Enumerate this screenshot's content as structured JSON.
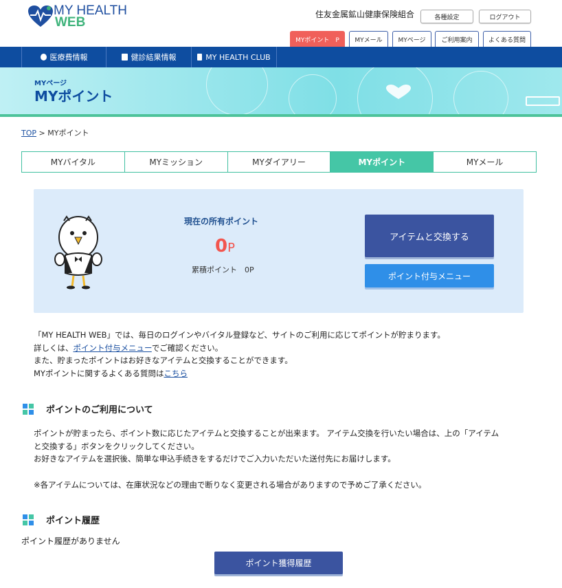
{
  "header": {
    "logo_line1": "MY HEALTH",
    "logo_line2": "WEB",
    "org_name": "住友金属鉱山健康保険組合",
    "settings_label": "各種設定",
    "logout_label": "ログアウト",
    "tabs": [
      {
        "label": "MYポイント　P",
        "active": true
      },
      {
        "label": "MYメール"
      },
      {
        "label": "MYページ"
      },
      {
        "label": "ご利用案内"
      },
      {
        "label": "よくある質問"
      }
    ]
  },
  "nav": {
    "items": [
      {
        "label": "医療費情報",
        "icon": "coins-icon"
      },
      {
        "label": "健診結果情報",
        "icon": "document-icon"
      },
      {
        "label": "MY HEALTH CLUB",
        "icon": "bookmark-icon"
      }
    ]
  },
  "banner": {
    "subtitle": "MYページ",
    "title": "MYポイント"
  },
  "breadcrumb": {
    "top": "TOP",
    "separator": " > ",
    "current": "MYポイント"
  },
  "subtabs": [
    {
      "label": "MYバイタル"
    },
    {
      "label": "MYミッション"
    },
    {
      "label": "MYダイアリー"
    },
    {
      "label": "MYポイント",
      "active": true
    },
    {
      "label": "MYメール"
    }
  ],
  "points": {
    "current_label": "現在の所有ポイント",
    "current_value": "0",
    "unit": "P",
    "total_label": "累積ポイント　0P",
    "exchange_button": "アイテムと交換する",
    "menu_button": "ポイント付与メニュー"
  },
  "intro": {
    "line1": "「MY HEALTH WEB」では、毎日のログインやバイタル登録など、サイトのご利用に応じてポイントが貯まります。",
    "line2_pre": "詳しくは、",
    "line2_link": "ポイント付与メニュー",
    "line2_post": "でご確認ください。",
    "line3": "また、貯まったポイントはお好きなアイテムと交換することができます。",
    "line4_pre": "MYポイントに関するよくある質問は",
    "line4_link": "こちら"
  },
  "usage": {
    "title": "ポイントのご利用について",
    "line1": "ポイントが貯まったら、ポイント数に応じたアイテムと交換することが出来ます。 アイテム交換を行いたい場合は、上の「アイテム",
    "line2": "と交換する」ボタンをクリックしてください。",
    "line3": "お好きなアイテムを選択後、簡単な申込手続きをするだけでご入力いただいた送付先にお届けします。",
    "note": "※各アイテムについては、在庫状況などの理由で断りなく変更される場合がありますので予めご了承ください。"
  },
  "history": {
    "title": "ポイント履歴",
    "empty": "ポイント履歴がありません",
    "button": "ポイント獲得履歴"
  },
  "colors": {
    "brand_blue": "#0e4da0",
    "accent_teal": "#45c6a6",
    "point_red": "#f2554e",
    "button_navy": "#3b54a0",
    "button_blue": "#2f8fe8"
  }
}
